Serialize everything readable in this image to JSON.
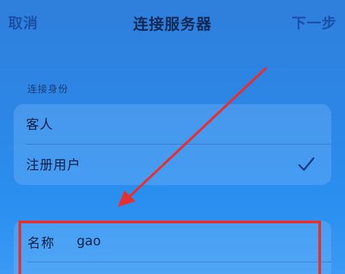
{
  "navbar": {
    "cancel_label": "取消",
    "title": "连接服务器",
    "next_label": "下一步"
  },
  "identity": {
    "section_label": "连接身份",
    "options": [
      {
        "label": "客人",
        "selected": false
      },
      {
        "label": "注册用户",
        "selected": true
      }
    ]
  },
  "credentials": {
    "name_label": "名称",
    "name_value": "gao"
  },
  "colors": {
    "accent": "#1a4fa8",
    "annotation": "#e53030"
  },
  "icons": {
    "selected": "checkmark-icon"
  }
}
